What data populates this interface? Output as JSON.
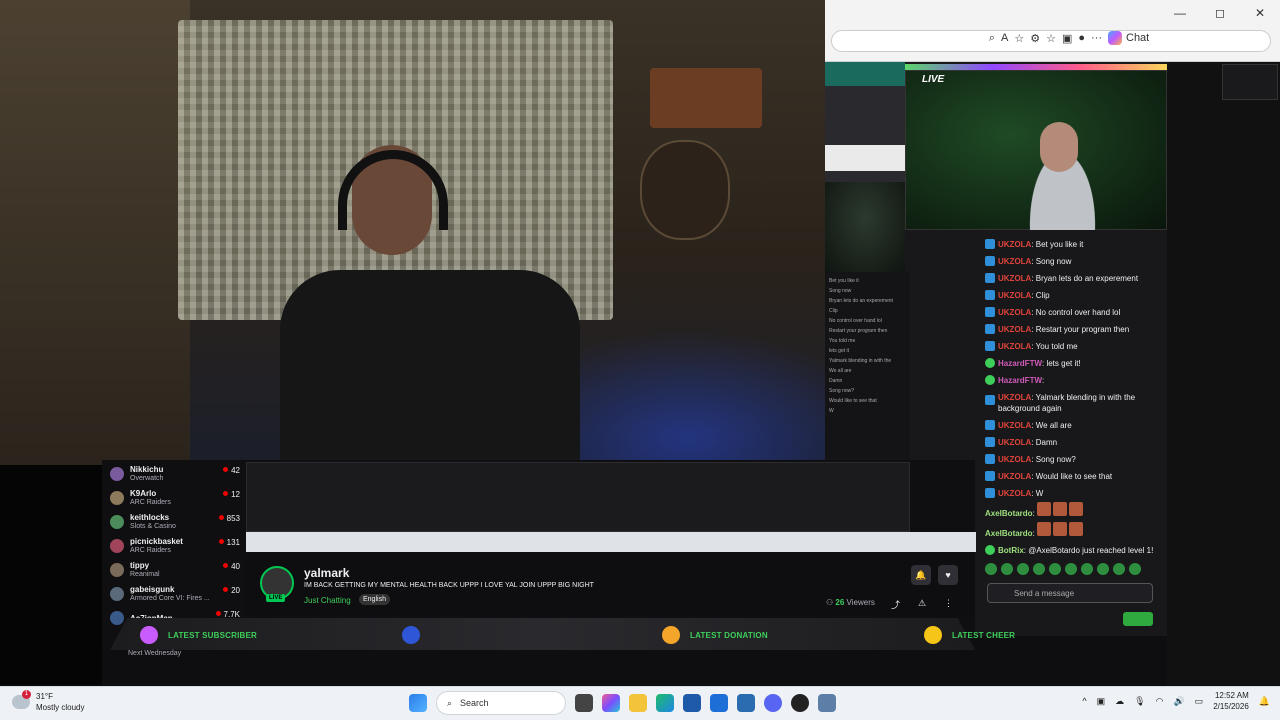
{
  "browser": {
    "chat_label": "Chat",
    "window_controls": [
      "—",
      "◻",
      "✕"
    ]
  },
  "nested_live": {
    "label": "LIVE",
    "mini_chat": [
      "Bet you like it",
      "Song now",
      "Bryan lets do an experement",
      "Clip",
      "No control over hand lol",
      "Restart your program then",
      "You told me",
      "lets get it",
      "Yalmark blending in with the",
      "We all are",
      "Damn",
      "Song now?",
      "Would like to see that",
      "W"
    ]
  },
  "chat": {
    "messages": [
      {
        "user": "UKZOLA",
        "text": ": Bet you like it",
        "badge": "sub",
        "color": "red"
      },
      {
        "user": "UKZOLA",
        "text": ": Song now",
        "badge": "sub",
        "color": "red"
      },
      {
        "user": "UKZOLA",
        "text": ": Bryan lets do an experement",
        "badge": "sub",
        "color": "red"
      },
      {
        "user": "UKZOLA",
        "text": ": Clip",
        "badge": "sub",
        "color": "red"
      },
      {
        "user": "UKZOLA",
        "text": ": No control over hand lol",
        "badge": "sub",
        "color": "red"
      },
      {
        "user": "UKZOLA",
        "text": ": Restart your program then",
        "badge": "sub",
        "color": "red"
      },
      {
        "user": "UKZOLA",
        "text": ": You told me",
        "badge": "sub",
        "color": "red"
      },
      {
        "user": "HazardFTW",
        "text": ": lets get it!",
        "badge": "mod",
        "color": "purple"
      },
      {
        "user": "HazardFTW",
        "text": ":",
        "badge": "mod",
        "color": "purple"
      },
      {
        "user": "UKZOLA",
        "text": ": Yalmark blending in with the background again",
        "badge": "sub",
        "color": "red",
        "wrap": true
      },
      {
        "user": "UKZOLA",
        "text": ": We all are",
        "badge": "sub",
        "color": "red"
      },
      {
        "user": "UKZOLA",
        "text": ": Damn",
        "badge": "sub",
        "color": "red"
      },
      {
        "user": "UKZOLA",
        "text": ": Song now?",
        "badge": "sub",
        "color": "red"
      },
      {
        "user": "UKZOLA",
        "text": ": Would like to see that",
        "badge": "sub",
        "color": "red"
      },
      {
        "user": "UKZOLA",
        "text": ": W",
        "badge": "sub",
        "color": "red"
      },
      {
        "user": "AxelBotardo",
        "text": ":",
        "badge": "none",
        "color": "green",
        "emotes": 3
      },
      {
        "user": "AxelBotardo",
        "text": ":",
        "badge": "none",
        "color": "green",
        "emotes": 3
      },
      {
        "user": "BotRix",
        "text": ": @AxelBotardo just reached level 1!",
        "badge": "mod",
        "color": "green"
      }
    ],
    "send_placeholder": "Send a message"
  },
  "channels": [
    {
      "name": "Nikkichu",
      "game": "Overwatch",
      "count": "42"
    },
    {
      "name": "K9Arlo",
      "game": "ARC Raiders",
      "count": "12"
    },
    {
      "name": "keithlocks",
      "game": "Slots & Casino",
      "count": "853"
    },
    {
      "name": "picnickbasket",
      "game": "ARC Raiders",
      "count": "131"
    },
    {
      "name": "tippy",
      "game": "Reanimal",
      "count": "40"
    },
    {
      "name": "gabeisgunk",
      "game": "Armored Core VI: Fires ...",
      "count": "20"
    },
    {
      "name": "Ac7ionMan",
      "game": "",
      "count": "7.7K"
    }
  ],
  "stream": {
    "live_badge": "LIVE",
    "name": "yalmark",
    "title": "IM BACK GETTING MY MENTAL HEALTH BACK UPPP I LOVE YAL JOIN UPPP BIG NIGHT",
    "category": "Just Chatting",
    "tag": "English",
    "viewers": "26",
    "viewers_label": "Viewers"
  },
  "alerts": {
    "subscriber": "LATEST SUBSCRIBER",
    "donation": "LATEST DONATION",
    "cheer": "LATEST CHEER",
    "schedule": "Next Wednesday"
  },
  "taskbar": {
    "temp": "31°F",
    "condition": "Mostly cloudy",
    "weather_badge": "1",
    "search": "Search",
    "time": "12:52 AM",
    "date": "2/15/2026"
  },
  "colors": {
    "accent": "#3ecf5b",
    "twitch_purple": "#9147ff",
    "taskbar": "#eef2f6"
  }
}
